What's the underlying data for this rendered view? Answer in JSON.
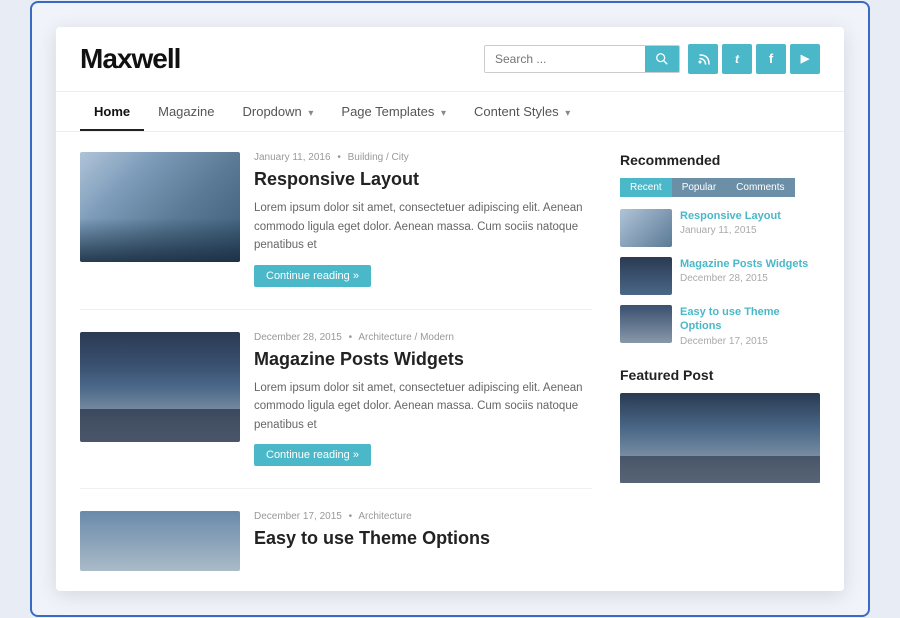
{
  "site": {
    "logo": "Maxwell",
    "search_placeholder": "Search ...",
    "nav_items": [
      {
        "label": "Home",
        "active": true,
        "has_arrow": false
      },
      {
        "label": "Magazine",
        "active": false,
        "has_arrow": false
      },
      {
        "label": "Dropdown",
        "active": false,
        "has_arrow": true
      },
      {
        "label": "Page Templates",
        "active": false,
        "has_arrow": true
      },
      {
        "label": "Content Styles",
        "active": false,
        "has_arrow": true
      }
    ]
  },
  "social_icons": [
    {
      "name": "rss",
      "symbol": "⌇"
    },
    {
      "name": "twitter",
      "symbol": "t"
    },
    {
      "name": "facebook",
      "symbol": "f"
    },
    {
      "name": "youtube",
      "symbol": "▶"
    }
  ],
  "posts": [
    {
      "date": "January 11, 2016",
      "category": "Building / City",
      "title": "Responsive Layout",
      "excerpt": "Lorem ipsum dolor sit amet, consectetuer adipiscing elit. Aenean commodo ligula eget dolor. Aenean massa. Cum sociis natoque penatibus et",
      "read_more": "Continue reading »",
      "image_type": "building"
    },
    {
      "date": "December 28, 2015",
      "category": "Architecture / Modern",
      "title": "Magazine Posts Widgets",
      "excerpt": "Lorem ipsum dolor sit amet, consectetuer adipiscing elit. Aenean commodo ligula eget dolor. Aenean massa. Cum sociis natoque penatibus et",
      "read_more": "Continue reading »",
      "image_type": "observatory"
    },
    {
      "date": "December 17, 2015",
      "category": "Architecture",
      "title": "Easy to use Theme Options",
      "excerpt": "",
      "read_more": "",
      "image_type": "partial"
    }
  ],
  "sidebar": {
    "recommended_title": "Recommended",
    "tabs": [
      "Recent",
      "Popular",
      "Comments"
    ],
    "active_tab": "Recent",
    "recommended_posts": [
      {
        "title": "Responsive Layout",
        "date": "January 11, 2015",
        "image_type": "s1"
      },
      {
        "title": "Magazine Posts Widgets",
        "date": "December 28, 2015",
        "image_type": "s2"
      },
      {
        "title": "Easy to use Theme Options",
        "date": "December 17, 2015",
        "image_type": "s3"
      }
    ],
    "featured_title": "Featured Post"
  }
}
